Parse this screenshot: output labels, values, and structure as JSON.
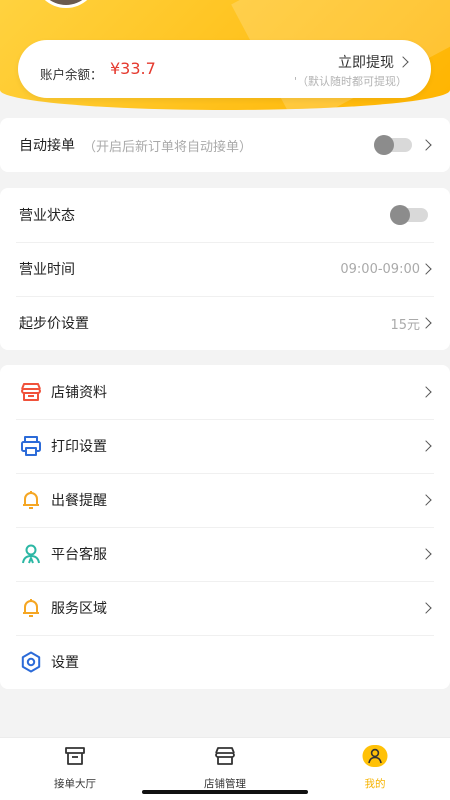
{
  "balance": {
    "label": "账户余额：",
    "amount": "¥33.7",
    "withdraw_label": "立即提现",
    "withdraw_hint": "'（默认随时都可提现）"
  },
  "auto_accept": {
    "label": "自动接单",
    "hint": "（开启后新订单将自动接单）",
    "enabled": false
  },
  "business": {
    "status_label": "营业状态",
    "status_enabled": false,
    "hours_label": "营业时间",
    "hours_value": "09:00-09:00",
    "min_price_label": "起步价设置",
    "min_price_value": "15元"
  },
  "menu": [
    {
      "label": "店铺资料",
      "icon": "store-icon"
    },
    {
      "label": "打印设置",
      "icon": "printer-icon"
    },
    {
      "label": "出餐提醒",
      "icon": "bell-icon"
    },
    {
      "label": "平台客服",
      "icon": "customer-service-icon"
    },
    {
      "label": "服务区域",
      "icon": "bell-icon"
    },
    {
      "label": "设置",
      "icon": "settings-gear-icon"
    }
  ],
  "tabbar": {
    "items": [
      {
        "label": "接单大厅",
        "icon": "box-icon"
      },
      {
        "label": "店铺管理",
        "icon": "store-icon"
      },
      {
        "label": "我的",
        "icon": "user-icon"
      }
    ],
    "active_index": 2
  },
  "colors": {
    "brand_yellow": "#ffbd1a",
    "balance_red": "#e53a2f",
    "icon_red": "#f0523b",
    "icon_blue": "#2c6bd8",
    "icon_orange": "#f5a623",
    "icon_teal": "#2bb7a4"
  }
}
